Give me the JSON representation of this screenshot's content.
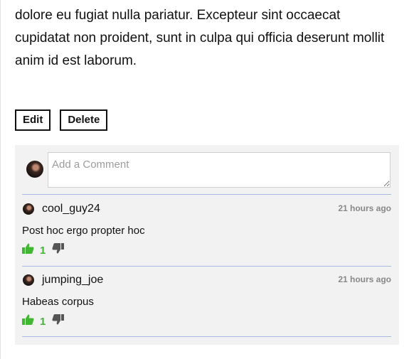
{
  "post": {
    "body": "dolore eu fugiat nulla pariatur. Excepteur sint occaecat cupidatat non proident, sunt in culpa qui officia deserunt mollit anim id est laborum.",
    "edit_label": "Edit",
    "delete_label": "Delete"
  },
  "composer": {
    "placeholder": "Add a Comment"
  },
  "comments": [
    {
      "username": "cool_guy24",
      "time": "21 hours ago",
      "text": "Post hoc ergo propter hoc",
      "upvotes": "1"
    },
    {
      "username": "jumping_joe",
      "time": "21 hours ago",
      "text": "Habeas corpus",
      "upvotes": "1"
    }
  ],
  "icons": {
    "upvote": "thumbs-up-icon",
    "downvote": "thumbs-down-icon"
  },
  "colors": {
    "upvote": "#41b633",
    "downvote": "#555555",
    "divider": "#aab8e6",
    "panel": "#f2f2f2"
  }
}
